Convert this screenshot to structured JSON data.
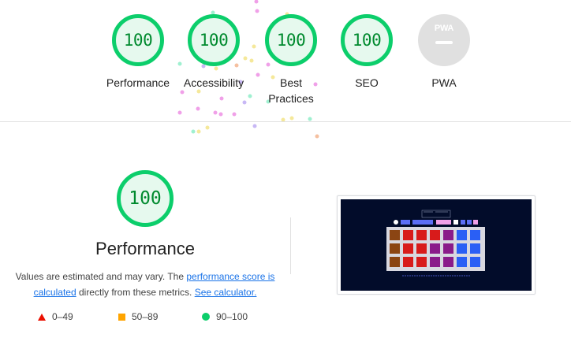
{
  "categories": [
    {
      "score": "100",
      "label": "Performance"
    },
    {
      "score": "100",
      "label": "Accessibility"
    },
    {
      "score": "100",
      "label": "Best Practices"
    },
    {
      "score": "100",
      "label": "SEO"
    }
  ],
  "pwa": {
    "badge_text": "PWA",
    "label": "PWA"
  },
  "performance": {
    "score": "100",
    "title": "Performance",
    "desc_prefix": "Values are estimated and may vary. The ",
    "desc_link1": "performance score is calculated",
    "desc_middle": " directly from these metrics. ",
    "desc_link2": "See calculator."
  },
  "legend": [
    {
      "range": "0–49",
      "color": "#eb0f00"
    },
    {
      "range": "50–89",
      "color": "#ffa400"
    },
    {
      "range": "90–100",
      "color": "#0cce6b"
    }
  ]
}
